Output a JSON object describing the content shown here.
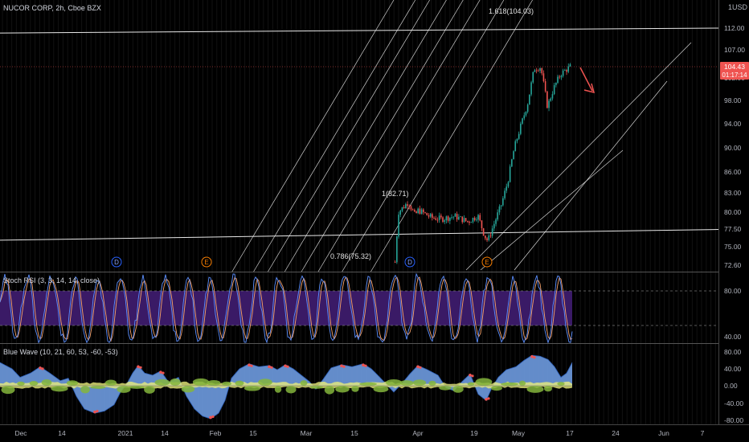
{
  "header": {
    "symbol_label": "NUCOR CORP, 2h, Cboe BZX",
    "currency": "USD",
    "price_tag": "104.43",
    "countdown_tag": "01:17:14"
  },
  "indicators": {
    "stoch_label": "Stoch RSI (3, 3, 14, 14, close)",
    "wave_label": "Blue Wave (10, 21, 60, 53, -60, -53)"
  },
  "annotations": {
    "fib_top": "1.618(104.03)",
    "fib_mid": "1(82.71)",
    "fib_low": "0.786(75.32)",
    "events": [
      "D",
      "E",
      "D",
      "E"
    ]
  },
  "colors": {
    "background": "#000000",
    "up_candle": "#26a69a",
    "down_candle": "#ef5350",
    "line_white": "#e8e8e8",
    "price_tag": "#ef5350",
    "stoch_band": "#3a1a66",
    "stoch_k": "#5b8fff",
    "stoch_d": "#f5a26b",
    "wave_fill": "#6e9be0",
    "wave_fill_neg": "#5b86d8",
    "wave_yellow": "#e8ec7a",
    "wave_green": "#84b53c",
    "event_blue": "#2962ff",
    "event_orange": "#f57c00",
    "arrow_red": "#ef5350"
  },
  "chart_data": {
    "type": "candlestick",
    "title": "NUCOR CORP, 2h, Cboe BZX",
    "price_axis": {
      "ticks": [
        "112.00",
        "107.00",
        "102.00",
        "98.00",
        "94.00",
        "90.00",
        "86.00",
        "83.00",
        "80.00",
        "77.50",
        "75.00",
        "72.60"
      ],
      "scale": "log",
      "currency_label": "USD",
      "top_label": "1"
    },
    "time_axis": {
      "ticks": [
        "Dec",
        "14",
        "2021",
        "14",
        "Feb",
        "15",
        "Mar",
        "15",
        "Apr",
        "19",
        "May",
        "17",
        "24",
        "Jun",
        "7"
      ]
    },
    "price_path": [
      [
        "Mar 25",
        73.0
      ],
      [
        "Mar 26",
        80.0
      ],
      [
        "Mar 29",
        81.5
      ],
      [
        "Mar 31",
        79.5
      ],
      [
        "Apr 1",
        80.3
      ],
      [
        "Apr 5",
        79.2
      ],
      [
        "Apr 8",
        79.0
      ],
      [
        "Apr 12",
        79.4
      ],
      [
        "Apr 14",
        79.0
      ],
      [
        "Apr 16",
        78.6
      ],
      [
        "Apr 19",
        79.5
      ],
      [
        "Apr 21",
        76.6
      ],
      [
        "Apr 22",
        75.9
      ],
      [
        "Apr 26",
        81.0
      ],
      [
        "Apr 28",
        84.5
      ],
      [
        "Apr 30",
        90.0
      ],
      [
        "May 4",
        97.5
      ],
      [
        "May 6",
        104.0
      ],
      [
        "May 8",
        104.3
      ],
      [
        "May 10",
        97.0
      ],
      [
        "May 12",
        100.5
      ],
      [
        "May 14",
        103.0
      ],
      [
        "May 17",
        104.43
      ]
    ],
    "last_price": "104.43",
    "horizontal_lines": [
      {
        "from": 111.0,
        "to": 112.0
      },
      {
        "from": 76.0,
        "to": 77.5
      }
    ],
    "fib_channel_levels": [
      "1.618(104.03)",
      "1(82.71)",
      "0.786(75.32)"
    ],
    "stoch_rsi": {
      "name": "Stoch RSI (3, 3, 14, 14, close)",
      "ticks": [
        "80.00",
        "40.00"
      ],
      "band": [
        20,
        80
      ],
      "range": [
        0,
        100
      ]
    },
    "blue_wave": {
      "name": "Blue Wave (10, 21, 60, 53, -60, -53)",
      "ticks": [
        "80.00",
        "40.00",
        "0.00",
        "-40.00",
        "-80.00"
      ],
      "range": [
        -95,
        95
      ],
      "wave_path": [
        [
          0,
          55
        ],
        [
          15,
          40
        ],
        [
          25,
          20
        ],
        [
          38,
          30
        ],
        [
          50,
          45
        ],
        [
          62,
          30
        ],
        [
          75,
          12
        ],
        [
          85,
          18
        ],
        [
          95,
          -25
        ],
        [
          105,
          -55
        ],
        [
          118,
          -65
        ],
        [
          130,
          -60
        ],
        [
          142,
          -45
        ],
        [
          150,
          -15
        ],
        [
          158,
          5
        ],
        [
          165,
          30
        ],
        [
          172,
          48
        ],
        [
          180,
          30
        ],
        [
          190,
          25
        ],
        [
          200,
          35
        ],
        [
          210,
          8
        ],
        [
          222,
          20
        ],
        [
          232,
          -25
        ],
        [
          242,
          -55
        ],
        [
          252,
          -72
        ],
        [
          262,
          -78
        ],
        [
          272,
          -65
        ],
        [
          280,
          -35
        ],
        [
          288,
          18
        ],
        [
          298,
          40
        ],
        [
          310,
          52
        ],
        [
          322,
          45
        ],
        [
          335,
          48
        ],
        [
          345,
          38
        ],
        [
          355,
          50
        ],
        [
          365,
          40
        ],
        [
          375,
          25
        ],
        [
          385,
          10
        ],
        [
          393,
          -8
        ],
        [
          402,
          15
        ],
        [
          412,
          42
        ],
        [
          425,
          50
        ],
        [
          438,
          45
        ],
        [
          452,
          52
        ],
        [
          462,
          40
        ],
        [
          470,
          25
        ],
        [
          480,
          5
        ],
        [
          490,
          -15
        ],
        [
          500,
          5
        ],
        [
          510,
          28
        ],
        [
          520,
          48
        ],
        [
          532,
          38
        ],
        [
          545,
          25
        ],
        [
          555,
          -5
        ],
        [
          565,
          -12
        ],
        [
          575,
          10
        ],
        [
          585,
          28
        ],
        [
          595,
          -20
        ],
        [
          605,
          -35
        ],
        [
          612,
          -5
        ],
        [
          620,
          20
        ],
        [
          630,
          38
        ],
        [
          642,
          45
        ],
        [
          652,
          60
        ],
        [
          662,
          72
        ],
        [
          672,
          70
        ],
        [
          682,
          62
        ],
        [
          690,
          45
        ],
        [
          698,
          20
        ],
        [
          705,
          30
        ],
        [
          712,
          55
        ]
      ]
    }
  }
}
